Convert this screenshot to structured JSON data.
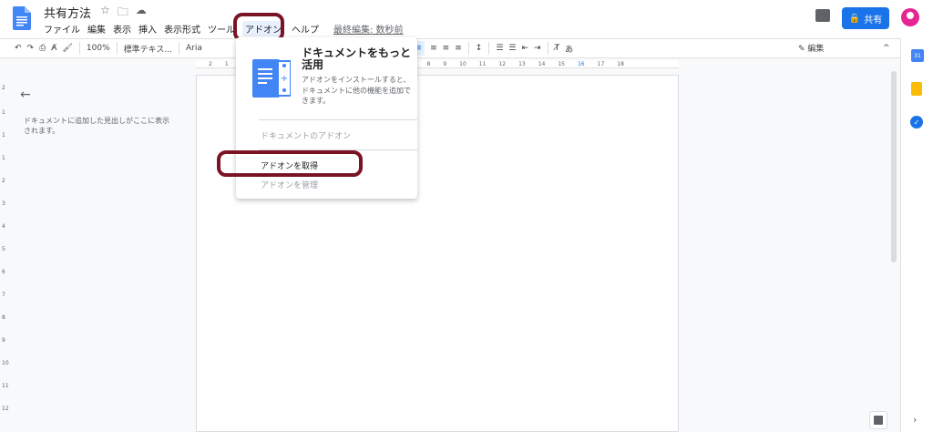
{
  "header": {
    "title": "共有方法",
    "star": "☆",
    "folder": "🗀",
    "cloud": "☁",
    "share_label": "共有",
    "share_icon": "🔒"
  },
  "menu": {
    "items": [
      "ファイル",
      "編集",
      "表示",
      "挿入",
      "表示形式",
      "ツール",
      "アドオン",
      "ヘルプ"
    ],
    "active": "アドオン",
    "last_edit": "最終編集: 数秒前"
  },
  "toolbar": {
    "undo": "↶",
    "redo": "↷",
    "print": "⎙",
    "spell": "A̸",
    "paint": "🖌",
    "zoom": "100%",
    "style": "標準テキス...",
    "font": "Aria",
    "link": "🔗",
    "comment": "⊞",
    "image": "▣",
    "align_left": "≡",
    "align_center": "≡",
    "align_right": "≡",
    "align_justify": "≡",
    "line_spacing": "↕",
    "checklist": "☰",
    "bullets": "☰",
    "outdent": "⇤",
    "indent": "⇥",
    "clear": "T̸",
    "input": "あ",
    "edit_mode": "✎ 編集",
    "collapse": "^"
  },
  "ruler": [
    "2",
    "1",
    "1",
    "2",
    "8",
    "9",
    "10",
    "11",
    "12",
    "13",
    "14",
    "15",
    "16",
    "17",
    "18"
  ],
  "vruler": [
    "2",
    "1",
    "1",
    "1",
    "2",
    "3",
    "4",
    "5",
    "6",
    "7",
    "8",
    "9",
    "10",
    "11",
    "12"
  ],
  "outline": {
    "back": "←",
    "text": "ドキュメントに追加した見出しがここに表示されます。"
  },
  "dropdown": {
    "promo_title": "ドキュメントをもっと活用",
    "promo_desc": "アドオンをインストールすると、ドキュメントに他の機能を追加できます。",
    "section_label": "ドキュメントのアドオン",
    "get_addons": "アドオンを取得",
    "manage_addons": "アドオンを管理"
  },
  "rail": {
    "calendar": "31",
    "tasks": "✓",
    "expand": "›"
  },
  "colors": {
    "highlight": "#7a1424",
    "accent": "#1a73e8"
  }
}
